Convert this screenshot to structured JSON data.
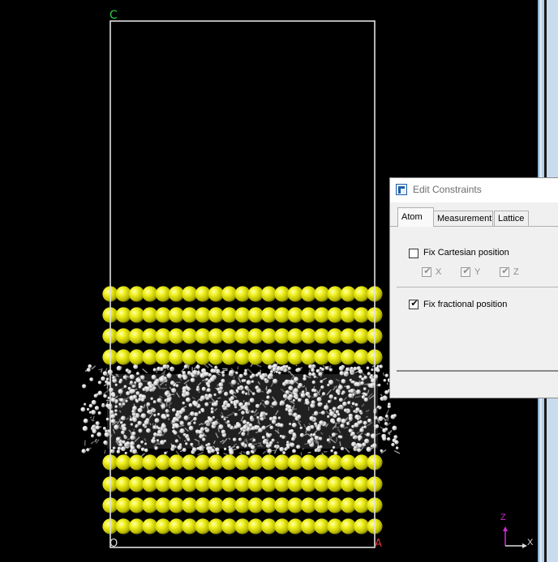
{
  "viewport": {
    "axis_labels": {
      "c": "C",
      "origin": "O",
      "a": "A"
    },
    "triad_labels": {
      "z": "Z",
      "x": "X"
    },
    "colors": {
      "background": "#000000",
      "cell_edge": "#e0e0e0",
      "gold_atom": "#e9e91a",
      "organic_atom": "#d8d8d8",
      "label_c": "#2ecc40",
      "label_a": "#e53935",
      "triad_z": "#d22ad2"
    }
  },
  "dialog": {
    "title": "Edit Constraints",
    "tabs": [
      {
        "label": "Atom",
        "active": true
      },
      {
        "label": "Measurement",
        "active": false
      },
      {
        "label": "Lattice",
        "active": false
      }
    ],
    "fix_cartesian": {
      "label": "Fix Cartesian position",
      "checked": false
    },
    "axes": [
      {
        "label": "X",
        "checked": true,
        "enabled": false
      },
      {
        "label": "Y",
        "checked": true,
        "enabled": false
      },
      {
        "label": "Z",
        "checked": true,
        "enabled": false
      }
    ],
    "fix_fractional": {
      "label": "Fix fractional position",
      "checked": true
    }
  }
}
